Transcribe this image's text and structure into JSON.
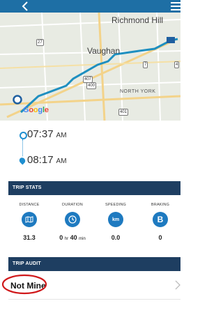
{
  "map": {
    "labels": {
      "richmond_hill": "Richmond Hill",
      "vaughan": "Vaughan",
      "north_york": "NORTH YORK"
    },
    "highways": {
      "h27": "27",
      "h7": "7",
      "h407": "407",
      "h400": "400",
      "h401": "401",
      "h4": "4"
    },
    "google": "Google",
    "route_color": "#1e8fc0"
  },
  "trip": {
    "start_time": "07:37",
    "start_ampm": "AM",
    "end_time": "08:17",
    "end_ampm": "AM"
  },
  "stats": {
    "header": "TRIP STATS",
    "distance": {
      "label": "DISTANCE",
      "value": "31.3",
      "icon": "map-icon"
    },
    "duration": {
      "label": "DURATION",
      "value_a": "0",
      "unit_a": "hr",
      "value_b": "40",
      "unit_b": "min",
      "icon": "clock-icon"
    },
    "speeding": {
      "label": "SPEEDING",
      "value": "0.0",
      "icon_text": "km"
    },
    "braking": {
      "label": "BRAKING",
      "value": "0",
      "icon_text": "B"
    }
  },
  "audit": {
    "header": "TRIP AUDIT",
    "value": "Not Mine"
  },
  "colors": {
    "topbar": "#1e6fa5",
    "section": "#1e3e61",
    "accent": "#1e7ac0",
    "highlight": "#d0191b"
  }
}
